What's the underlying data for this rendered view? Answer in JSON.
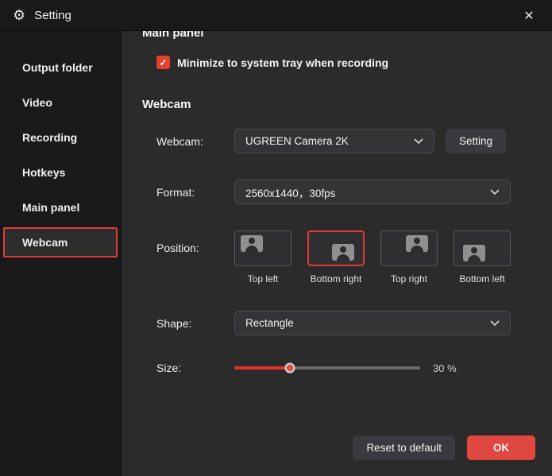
{
  "titlebar": {
    "title": "Setting",
    "close_glyph": "✕",
    "gear_glyph": "⚙"
  },
  "sidebar": {
    "items": [
      {
        "label": "Output folder",
        "selected": false
      },
      {
        "label": "Video",
        "selected": false
      },
      {
        "label": "Recording",
        "selected": false
      },
      {
        "label": "Hotkeys",
        "selected": false
      },
      {
        "label": "Main panel",
        "selected": false
      },
      {
        "label": "Webcam",
        "selected": true
      }
    ]
  },
  "main": {
    "sections": {
      "main_panel": {
        "title": "Main panel",
        "checkbox": {
          "checked": true,
          "glyph": "✓",
          "label": "Minimize to system tray when recording"
        }
      },
      "webcam": {
        "title": "Webcam",
        "rows": {
          "webcam": {
            "label": "Webcam:",
            "value": "UGREEN Camera 2K",
            "setting_button": "Setting"
          },
          "format": {
            "label": "Format:",
            "value": "2560x1440，30fps"
          },
          "position": {
            "label": "Position:",
            "options": [
              {
                "label": "Top left",
                "selected": false
              },
              {
                "label": "Bottom right",
                "selected": true
              },
              {
                "label": "Top right",
                "selected": false
              },
              {
                "label": "Bottom left",
                "selected": false
              }
            ]
          },
          "shape": {
            "label": "Shape:",
            "value": "Rectangle"
          },
          "size": {
            "label": "Size:",
            "percent": 30,
            "value_text": "30 %"
          }
        }
      }
    }
  },
  "footer": {
    "reset_button": "Reset to default",
    "ok_button": "OK"
  },
  "colors": {
    "accent_red": "#e03b37",
    "checkbox_red": "#e5402c",
    "ok_red": "#e04741",
    "titlebar_bg": "#191919",
    "sidebar_bg": "#1a1a1a",
    "content_bg": "#2b2b2c",
    "control_bg": "#343437"
  }
}
